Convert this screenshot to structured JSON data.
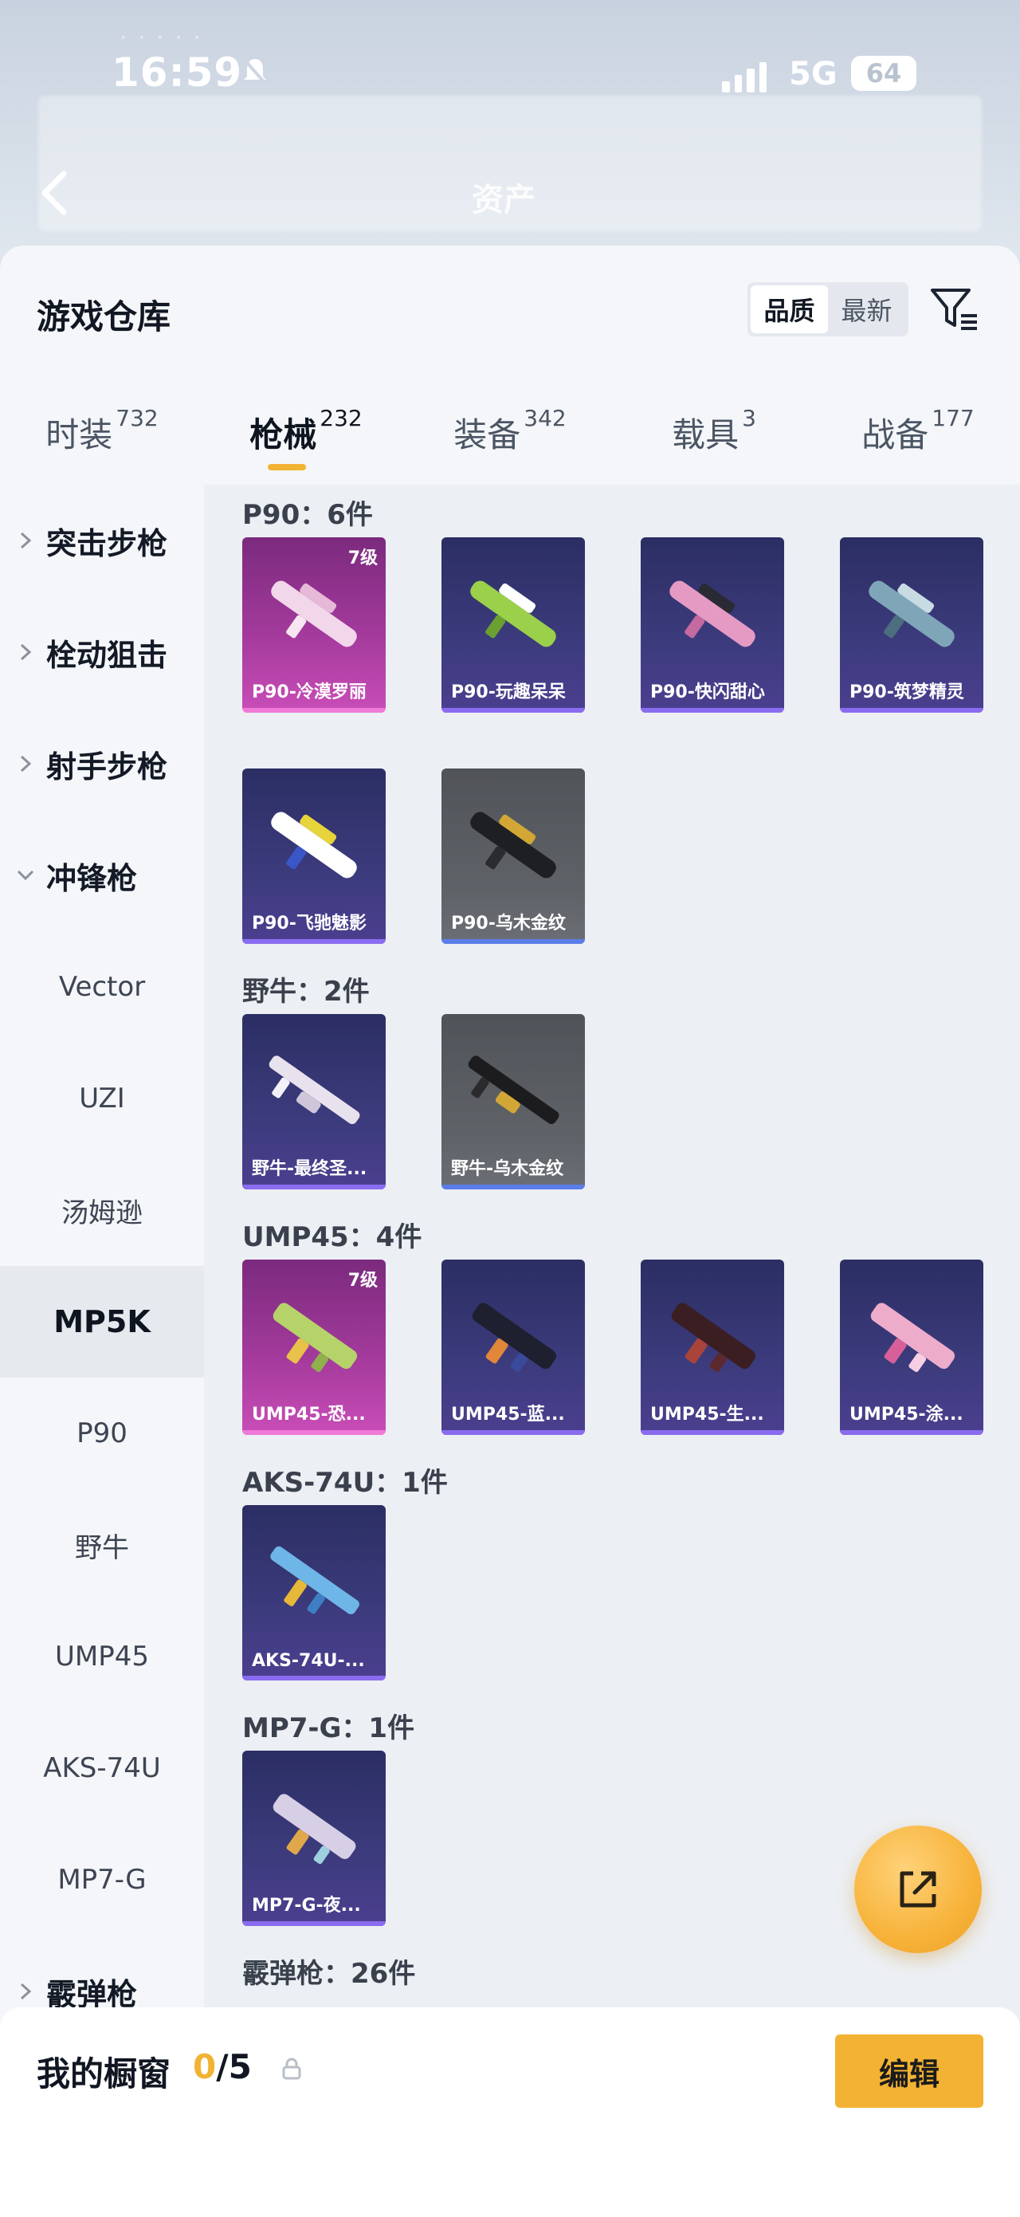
{
  "status_bar": {
    "time": "16:59",
    "network": "5G",
    "battery": "64"
  },
  "header": {
    "title": "资产"
  },
  "sheet": {
    "title": "游戏仓库",
    "sort_options": [
      "品质",
      "最新"
    ],
    "sort_active": "品质"
  },
  "tabs": [
    {
      "label": "时装",
      "count": "732"
    },
    {
      "label": "枪械",
      "count": "232"
    },
    {
      "label": "装备",
      "count": "342"
    },
    {
      "label": "载具",
      "count": "3"
    },
    {
      "label": "战备",
      "count": "177"
    }
  ],
  "sidebar": {
    "groups": {
      "assault": "突击步枪",
      "bolt": "栓动狙击",
      "marksman": "射手步枪",
      "smg": "冲锋枪",
      "shotgun": "霰弹枪"
    },
    "items": [
      "Vector",
      "UZI",
      "汤姆逊",
      "MP5K",
      "P90",
      "野牛",
      "UMP45",
      "AKS-74U",
      "MP7-G"
    ],
    "active_item": "MP5K"
  },
  "sections": [
    {
      "title": "P90：6件",
      "items": [
        {
          "name": "P90-冷漠罗丽",
          "level": "7级",
          "tier": "pink"
        },
        {
          "name": "P90-玩趣呆呆",
          "tier": "purple"
        },
        {
          "name": "P90-快闪甜心",
          "tier": "purple"
        },
        {
          "name": "P90-筑梦精灵",
          "tier": "purple"
        },
        {
          "name": "P90-飞驰魅影",
          "tier": "purple"
        },
        {
          "name": "P90-乌木金纹",
          "tier": "gray"
        }
      ]
    },
    {
      "title": "野牛：2件",
      "items": [
        {
          "name": "野牛-最终圣...",
          "tier": "purple"
        },
        {
          "name": "野牛-乌木金纹",
          "tier": "gray"
        }
      ]
    },
    {
      "title": "UMP45：4件",
      "items": [
        {
          "name": "UMP45-恐...",
          "level": "7级",
          "tier": "pink"
        },
        {
          "name": "UMP45-蓝...",
          "tier": "purple"
        },
        {
          "name": "UMP45-生...",
          "tier": "purple"
        },
        {
          "name": "UMP45-涂...",
          "tier": "purple"
        }
      ]
    },
    {
      "title": "AKS-74U：1件",
      "items": [
        {
          "name": "AKS-74U-...",
          "tier": "purple"
        }
      ]
    },
    {
      "title": "MP7-G：1件",
      "items": [
        {
          "name": "MP7-G-夜...",
          "tier": "purple"
        }
      ]
    },
    {
      "title": "霰弹枪：26件",
      "items": []
    }
  ],
  "showcase": {
    "label": "我的橱窗",
    "current": "0",
    "total": "/5",
    "edit_label": "编辑"
  },
  "colors": {
    "accent": "#f2b233",
    "purple_tier": "#3c3b7d",
    "pink_tier": "#a33a9b",
    "gray_tier": "#5f6368"
  }
}
